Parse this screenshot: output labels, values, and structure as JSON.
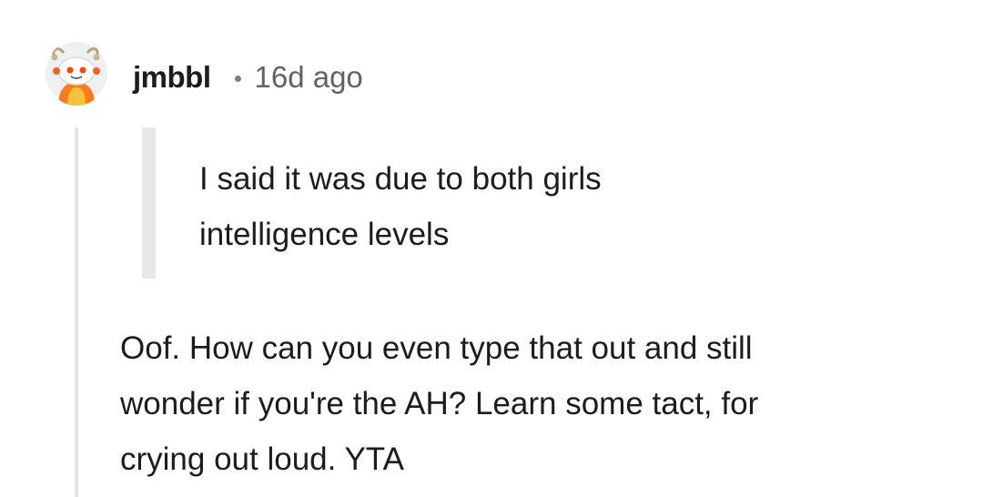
{
  "comment": {
    "username": "jmbbl",
    "separator": "•",
    "timestamp": "16d ago",
    "quote_lines": [
      "I said it was due to both girls",
      "intelligence levels"
    ],
    "body_lines": [
      "Oof. How can you even type that out and still",
      "wonder if you're the AH? Learn some tact, for",
      "crying out loud. YTA"
    ],
    "avatar_icon": "snoo-avatar-icon"
  },
  "colors": {
    "username": "#1c1c1c",
    "timestamp": "#5f6368",
    "thread_line": "#e6e6e6",
    "quote_bar": "#e8e8e8",
    "avatar_accent": "#ff4500"
  }
}
